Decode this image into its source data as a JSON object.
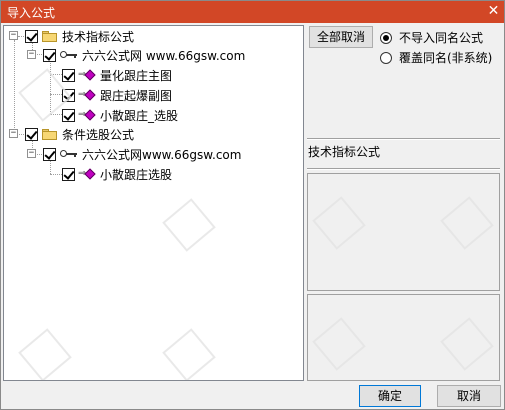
{
  "window": {
    "title": "导入公式",
    "close_icon": "close-icon"
  },
  "tree": {
    "nodes": [
      {
        "label": "技术指标公式",
        "icon": "folder-icon",
        "expander": "−",
        "checked": true
      },
      {
        "label": "六六公式网 www.66gsw.com",
        "icon": "key-icon",
        "expander": "−",
        "checked": true
      },
      {
        "label": "量化跟庄主图",
        "icon": "formula-icon",
        "checked": true
      },
      {
        "label": "跟庄起爆副图",
        "icon": "formula-icon",
        "checked": true
      },
      {
        "label": "小散跟庄_选股",
        "icon": "formula-icon",
        "checked": true
      },
      {
        "label": "条件选股公式",
        "icon": "folder-icon",
        "expander": "−",
        "checked": true
      },
      {
        "label": "六六公式网www.66gsw.com",
        "icon": "key-icon",
        "expander": "−",
        "checked": true
      },
      {
        "label": "小散跟庄选股",
        "icon": "formula-icon",
        "checked": true
      }
    ]
  },
  "options": {
    "deselect_all": "全部取消",
    "radio_skip": "不导入同名公式",
    "radio_overwrite": "覆盖同名(非系统)",
    "selected": "skip"
  },
  "detail": {
    "category_label": "技术指标公式"
  },
  "footer": {
    "ok": "确定",
    "cancel": "取消"
  }
}
